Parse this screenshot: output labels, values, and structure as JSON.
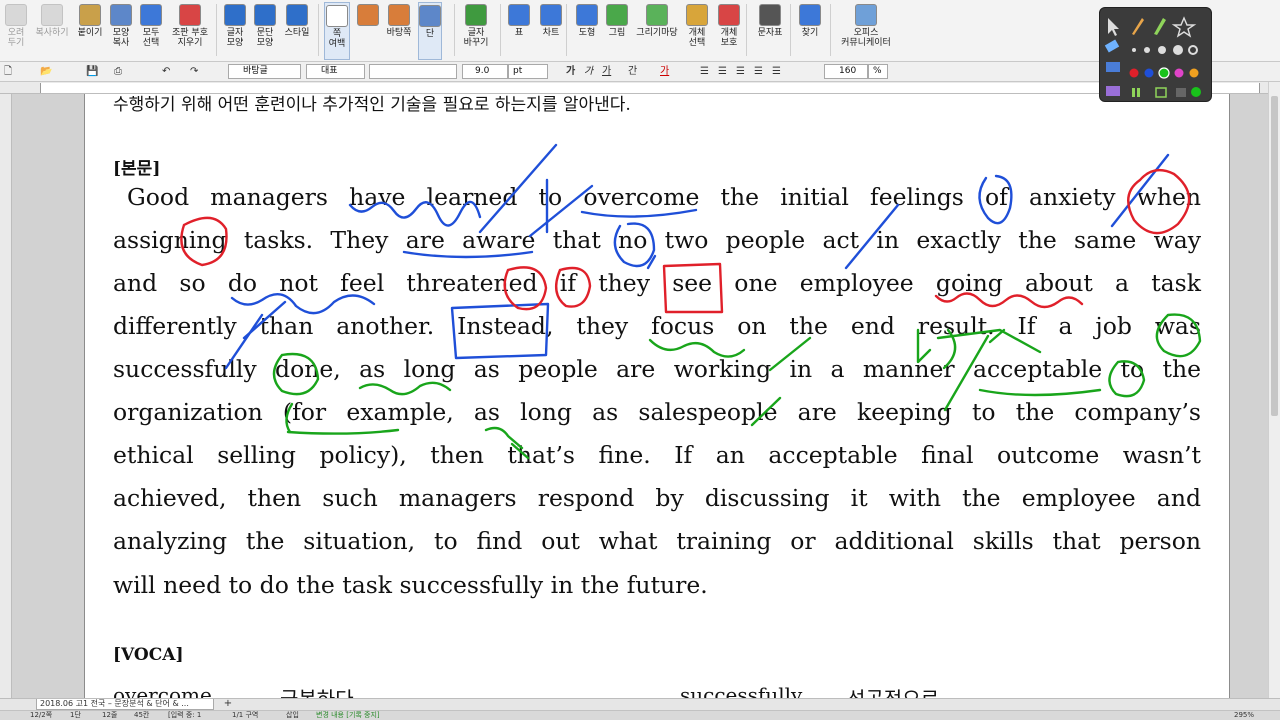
{
  "ribbon": {
    "buttons": [
      {
        "icon": "scissors-icon",
        "label": "오려\n두기",
        "dim": true
      },
      {
        "icon": "copy-icon",
        "label": "복사하기",
        "dim": true
      },
      {
        "icon": "paste-icon",
        "label": "붙이기",
        "dim": false
      },
      {
        "icon": "format-copy-icon",
        "label": "모양\n복사",
        "dim": false
      },
      {
        "icon": "select-all-icon",
        "label": "모두\n선택",
        "dim": false
      },
      {
        "icon": "clear-format-icon",
        "label": "조판 부호\n지우기",
        "dim": false
      },
      {
        "icon": "char-shape-icon",
        "label": "글자\n모양",
        "dim": false
      },
      {
        "icon": "para-shape-icon",
        "label": "문단\n모양",
        "dim": false
      },
      {
        "icon": "style-icon",
        "label": "스타일",
        "dim": false
      },
      {
        "icon": "page-icon",
        "label": "쪽\n여백",
        "dim": false
      },
      {
        "icon": "bg-icon",
        "label": "",
        "dim": false
      },
      {
        "icon": "page-border-icon",
        "label": "바탕쪽",
        "dim": false
      },
      {
        "icon": "columns-icon",
        "label": "단",
        "dim": false
      },
      {
        "icon": "font-change-icon",
        "label": "글자\n바꾸기",
        "dim": false
      },
      {
        "icon": "table-icon",
        "label": "표",
        "dim": false
      },
      {
        "icon": "chart-icon",
        "label": "차트",
        "dim": false
      },
      {
        "icon": "shape-icon",
        "label": "도형",
        "dim": false
      },
      {
        "icon": "picture-icon",
        "label": "그림",
        "dim": false
      },
      {
        "icon": "gallery-icon",
        "label": "그리기마당",
        "dim": false
      },
      {
        "icon": "object-select-icon",
        "label": "개체\n선택",
        "dim": false
      },
      {
        "icon": "object-protect-icon",
        "label": "개체\n보호",
        "dim": false
      },
      {
        "icon": "symbol-icon",
        "label": "문자표",
        "dim": false
      },
      {
        "icon": "find-icon",
        "label": "찾기",
        "dim": false
      },
      {
        "icon": "community-icon",
        "label": "오피스\n커뮤니케이터",
        "dim": false
      }
    ]
  },
  "format_toolbar": {
    "style": "바탕글",
    "lang": "대표",
    "font": "",
    "size": "9.0",
    "unit": "pt",
    "zoom": "160",
    "zoom_unit": "%"
  },
  "document": {
    "top_line": "수행하기 위해 어떤 훈련이나 추가적인 기술을 필요로 하는지를 알아낸다.",
    "body_heading": "[본문]",
    "lines": [
      "Good managers have learned to overcome the initial feelings of anxiety when",
      "assigning tasks. They are aware that no two people act in exactly the same way",
      "and so do not feel threatened if they see one employee going about a task",
      "differently than another. Instead, they focus on the end result. If a job was",
      "successfully done, as long as people are working in a manner acceptable to the",
      "organization (for example, as long as salespeople are keeping to the company’s",
      "ethical selling policy), then that’s fine. If an acceptable final outcome wasn’t",
      "achieved, then such managers respond by discussing it with the employee and",
      "analyzing the situation, to find out what training or additional skills that person",
      "will need to do the task successfully in the future."
    ],
    "voca_heading": "[VOCA]",
    "voca_row": [
      "overcome",
      "극복하다",
      "successfully",
      "성공적으로"
    ]
  },
  "tabs": {
    "doc_tab": "2018.06 고1 전국 – 문장분석 & 단어 & ...",
    "add": "+"
  },
  "status": {
    "items": [
      "12/2쪽",
      "1단",
      "12줄",
      "45칸",
      "[입력 중: 1",
      "1/1 구역",
      "삽입",
      "변경 내용 [기록 중지]"
    ],
    "zoom": "295%"
  },
  "ink_colors": {
    "blue": "#1f4fd8",
    "red": "#e0202a",
    "green": "#19a51b"
  }
}
